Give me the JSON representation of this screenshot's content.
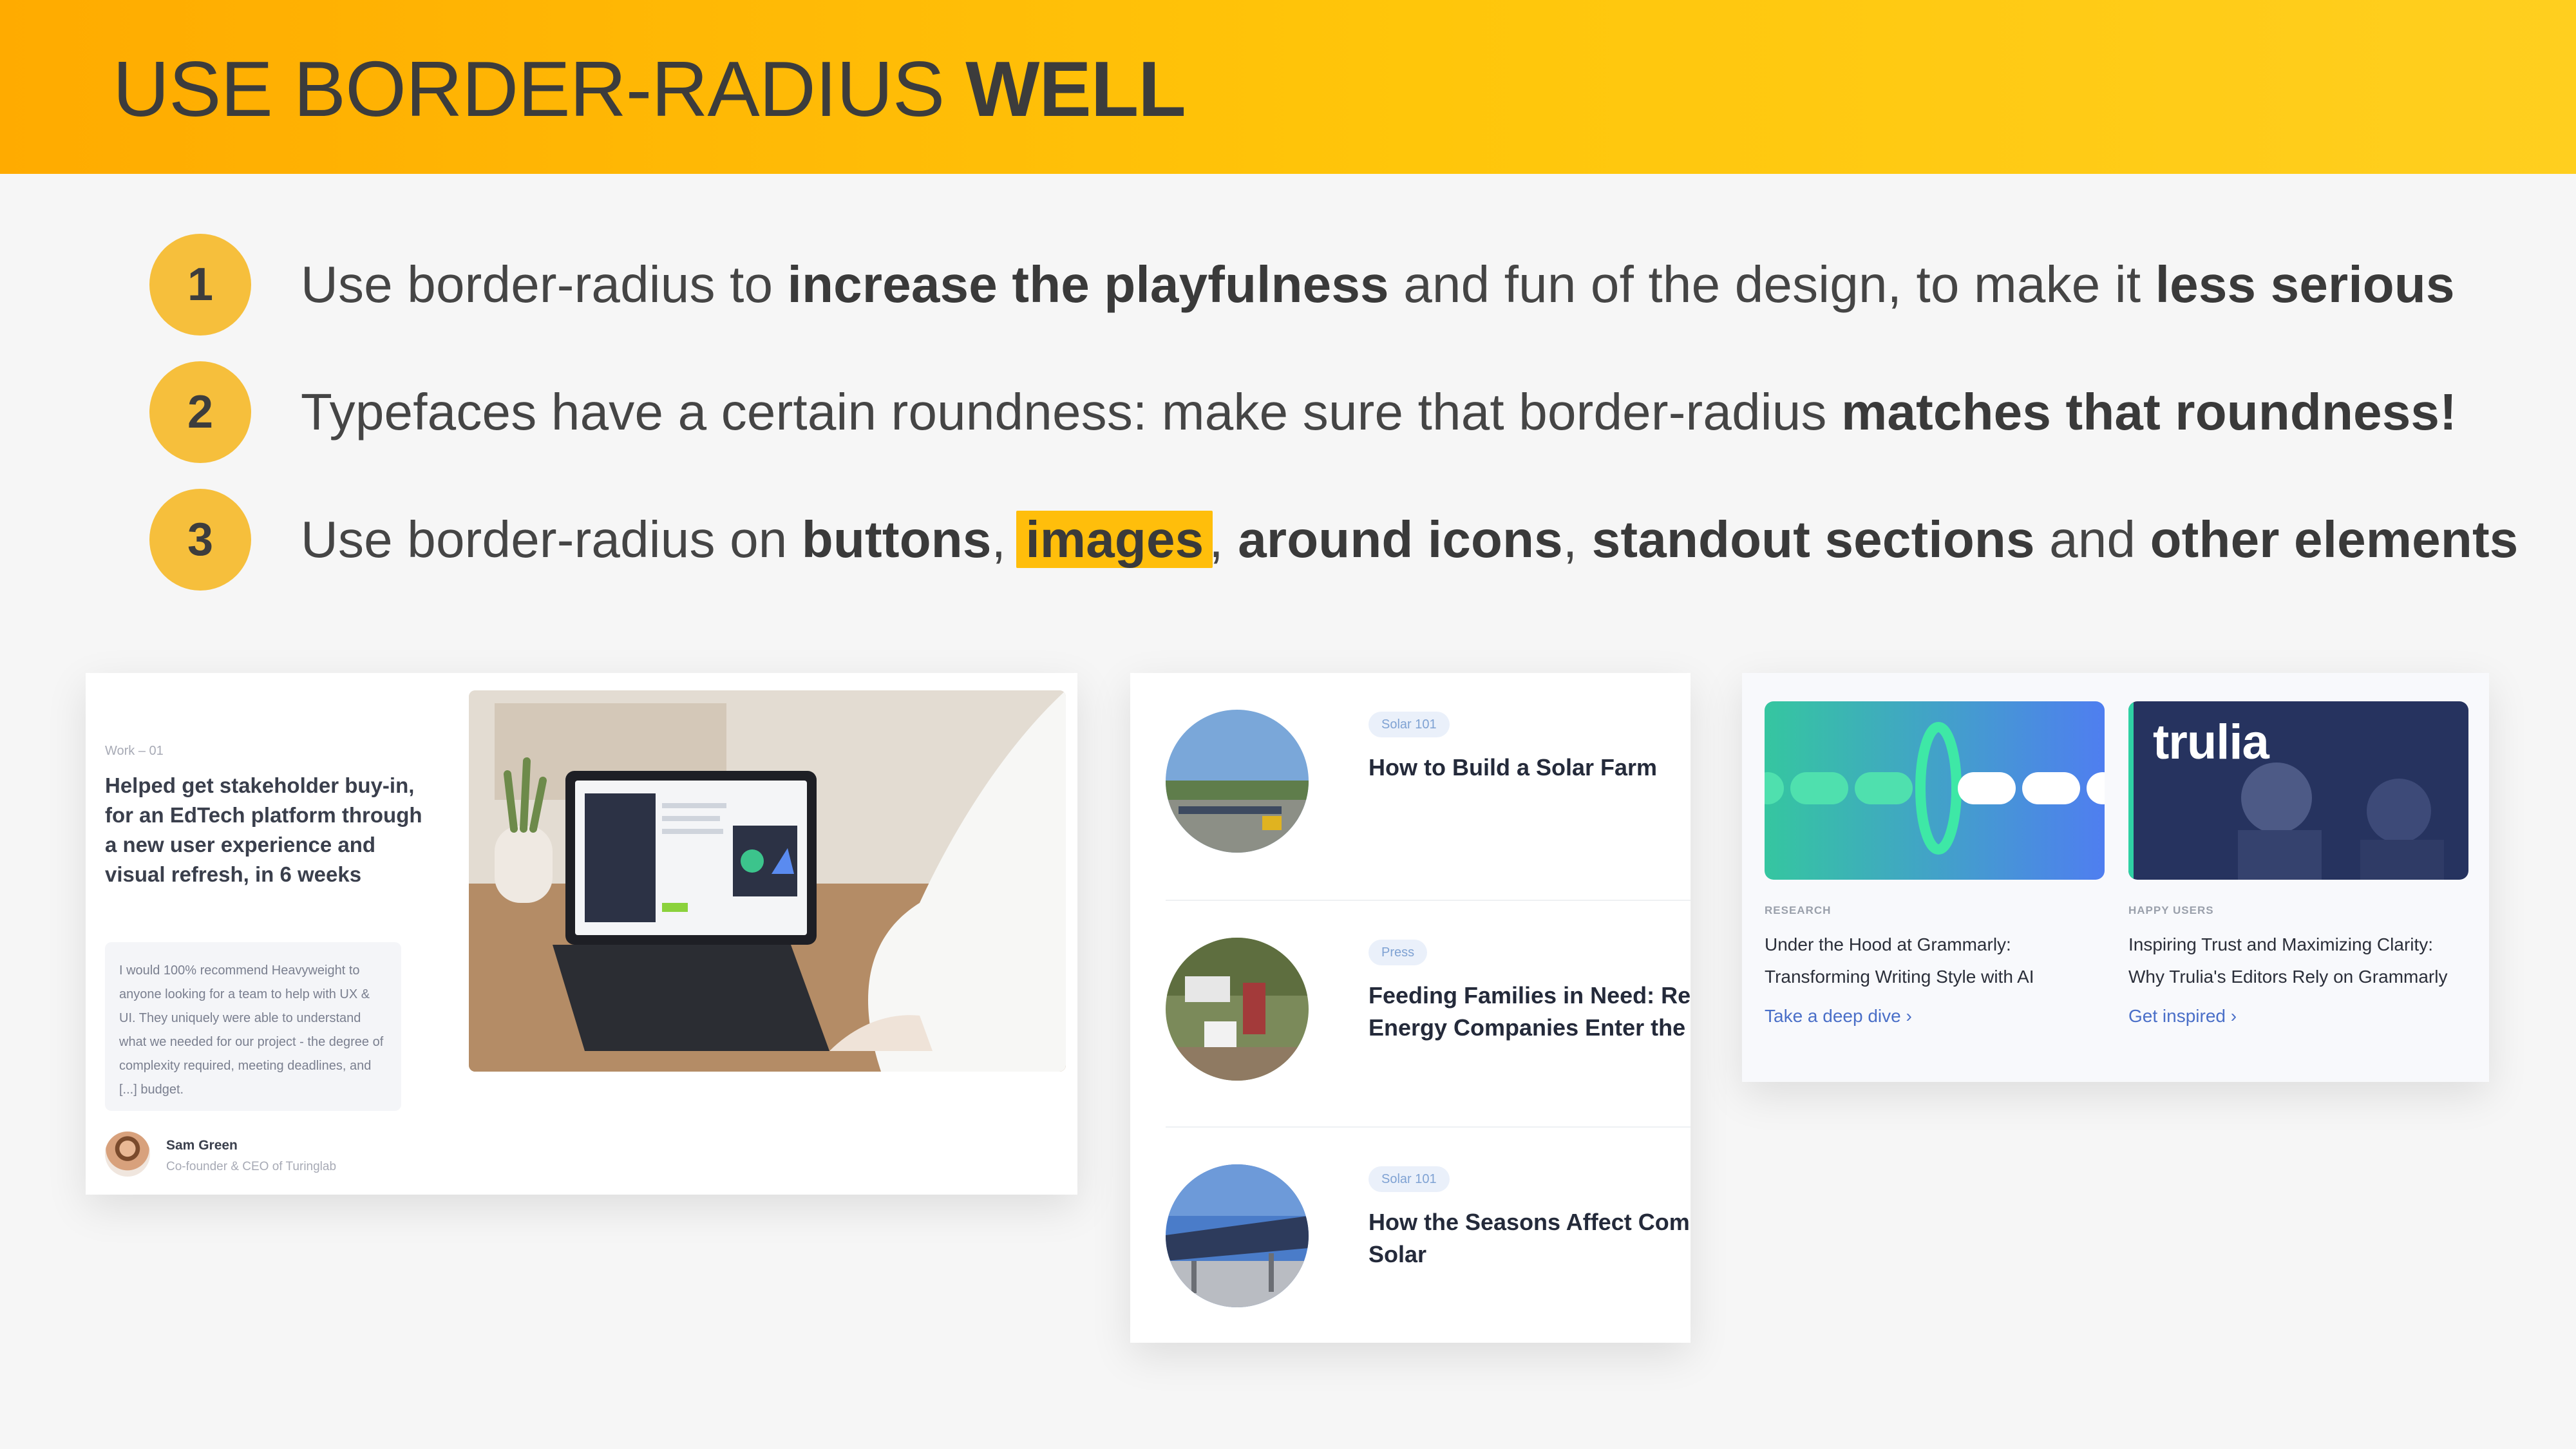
{
  "header": {
    "title_regular": "USE BORDER-RADIUS ",
    "title_bold": "WELL"
  },
  "points": [
    {
      "num": "1",
      "parts": [
        "Use border-radius to ",
        "increase the playfulness",
        " and fun of the design, to make it ",
        "less serious"
      ]
    },
    {
      "num": "2",
      "parts": [
        "Typefaces have a certain roundness: make sure that border-radius ",
        "matches that roundness!"
      ]
    },
    {
      "num": "3",
      "parts": [
        "Use border-radius on ",
        "buttons",
        ", ",
        "images",
        ", ",
        "around icons",
        ", ",
        "standout sections",
        " and ",
        "other elements"
      ]
    }
  ],
  "card1": {
    "eyebrow": "Work – 01",
    "title": "Helped get stakeholder buy-in, for an EdTech platform through a new user experience and visual refresh, in 6 weeks",
    "quote": "I would 100% recommend Heavyweight to anyone looking for a team to help with UX & UI. They uniquely were able to understand what we needed for our project - the degree of complexity required, meeting deadlines, and [...] budget.",
    "author_name": "Sam Green",
    "author_role": "Co-founder & CEO of Turinglab"
  },
  "card2": {
    "items": [
      {
        "tag": "Solar 101",
        "title_line1": "How to Build a Solar Farm",
        "title_line2": ""
      },
      {
        "tag": "Press",
        "title_line1": "Feeding Families in Need: Ren",
        "title_line2": "Energy Companies Enter the M"
      },
      {
        "tag": "Solar 101",
        "title_line1": "How the Seasons Affect Comr",
        "title_line2": "Solar"
      }
    ]
  },
  "card3": {
    "items": [
      {
        "eyebrow": "RESEARCH",
        "title_line1": "Under the Hood at Grammarly:",
        "title_line2": "Transforming Writing Style with AI",
        "link": "Take a deep dive ›"
      },
      {
        "eyebrow": "HAPPY USERS",
        "title_line1": "Inspiring Trust and Maximizing Clarity:",
        "title_line2": "Why Trulia's Editors Rely on Grammarly",
        "link": "Get inspired ›",
        "logo": "trulia"
      }
    ]
  }
}
